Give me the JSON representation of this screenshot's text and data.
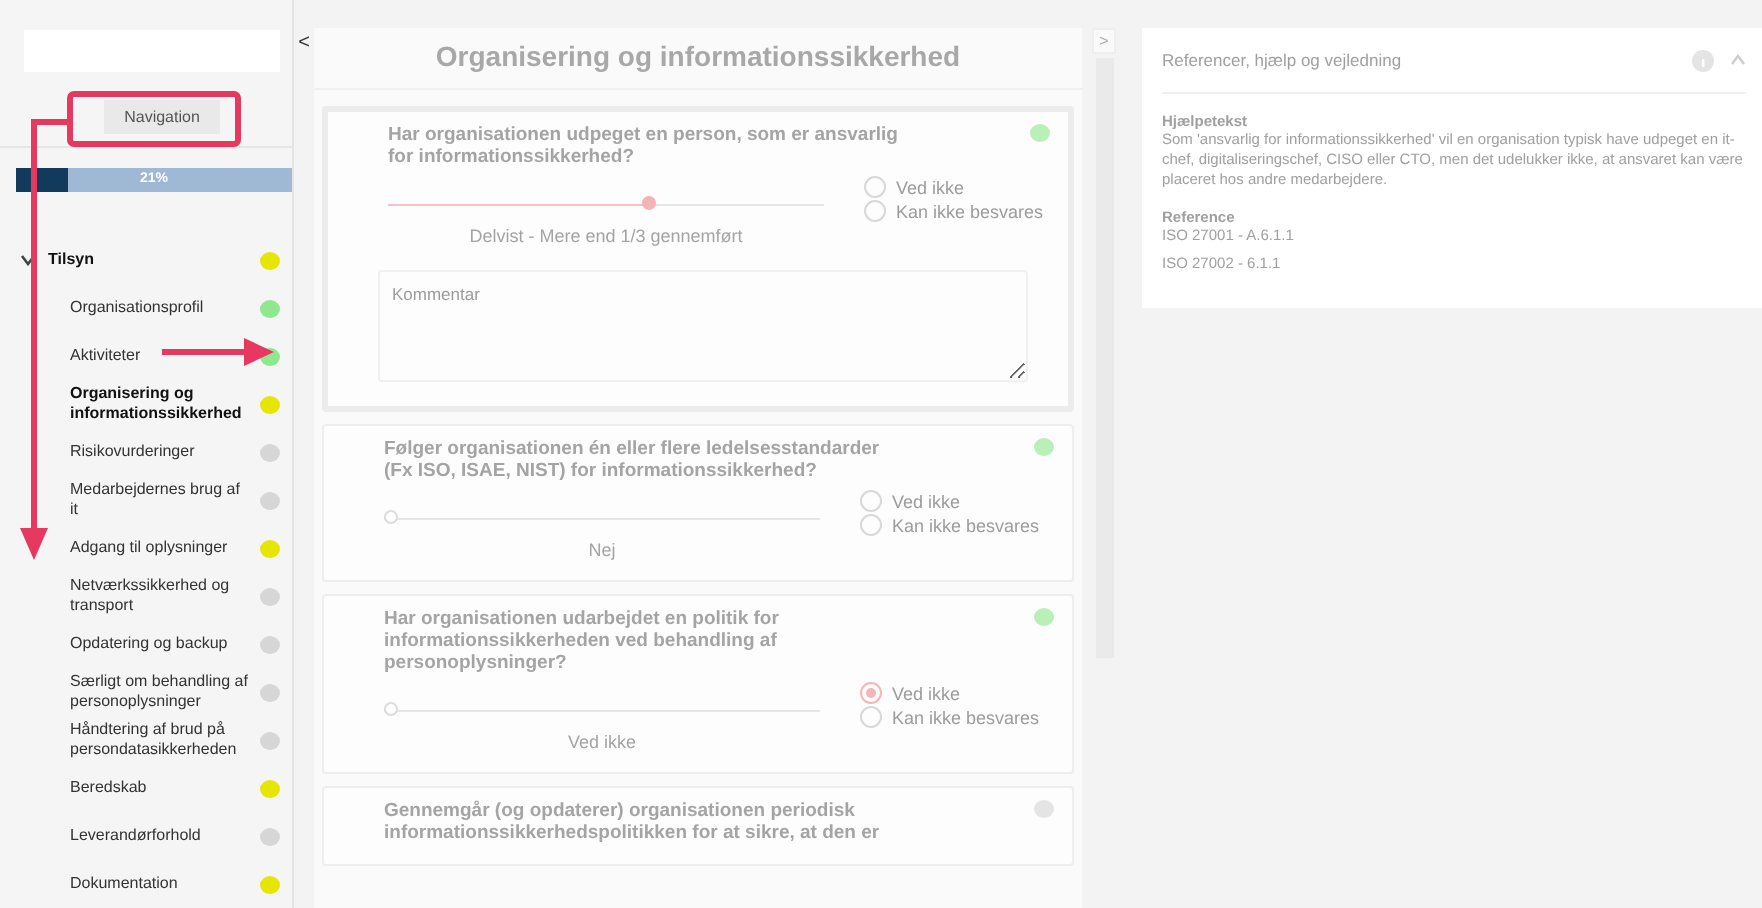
{
  "sidebar": {
    "tab": "Navigation",
    "progress": {
      "level": 0.19,
      "label": "21%"
    },
    "tree": {
      "label": "Tilsyn",
      "expanded": true,
      "color": "#e6e600",
      "children": [
        {
          "label": "Organisationsprofil",
          "color": "#8ee88e",
          "selected": false
        },
        {
          "label": "Aktiviteter",
          "color": "#8ee88e",
          "selected": false
        },
        {
          "label": "Organisering og informationssikkerhed",
          "color": "#e6e600",
          "selected": true
        },
        {
          "label": "Risikovurderinger",
          "color": "#d6d6d6",
          "selected": false
        },
        {
          "label": "Medarbejdernes brug af it",
          "color": "#d6d6d6",
          "selected": false
        },
        {
          "label": "Adgang til oplysninger",
          "color": "#e6e600",
          "selected": false
        },
        {
          "label": "Netværkssikkerhed og transport",
          "color": "#d6d6d6",
          "selected": false
        },
        {
          "label": "Opdatering og backup",
          "color": "#d6d6d6",
          "selected": false
        },
        {
          "label": "Særligt om behandling af personoplysninger",
          "color": "#d6d6d6",
          "selected": false
        },
        {
          "label": "Håndtering af brud på persondatasikkerheden",
          "color": "#d6d6d6",
          "selected": false
        },
        {
          "label": "Beredskab",
          "color": "#e6e600",
          "selected": false
        },
        {
          "label": "Leverandørforhold",
          "color": "#d6d6d6",
          "selected": false
        },
        {
          "label": "Dokumentation",
          "color": "#e6e600",
          "selected": false
        }
      ]
    }
  },
  "main": {
    "collapse_left": "<",
    "collapse_right": ">",
    "title": "Organisering og informationssikkerhed",
    "questions": [
      {
        "text": "Har organisationen udpeget en person, som er ansvarlig for informationssikkerhed?",
        "color": "#b8f0b8",
        "level": 0.6,
        "value_label": "Delvist - Mere end 1/3 gennemført",
        "options": [
          {
            "label": "Ved ikke",
            "selected": false
          },
          {
            "label": "Kan ikke besvares",
            "selected": false
          }
        ],
        "comment": {
          "placeholder": "Kommentar"
        }
      },
      {
        "text": "Følger organisationen én eller flere ledelsesstandarder (Fx ISO, ISAE, NIST) for informationssikkerhed?",
        "color": "#b8f0b8",
        "level": 0,
        "value_label": "Nej",
        "options": [
          {
            "label": "Ved ikke",
            "selected": false
          },
          {
            "label": "Kan ikke besvares",
            "selected": false
          }
        ]
      },
      {
        "text": "Har organisationen udarbejdet en politik for informationssikkerheden ved behandling af personoplysninger?",
        "color": "#b8f0b8",
        "level": 0,
        "value_label": "Ved ikke",
        "options": [
          {
            "label": "Ved ikke",
            "selected": true
          },
          {
            "label": "Kan ikke besvares",
            "selected": false
          }
        ]
      },
      {
        "text": "Gennemgår (og opdaterer) organisationen periodisk informationssikkerhedspolitikken for at sikre, at den er",
        "color": "#e4e4e4"
      }
    ]
  },
  "help": {
    "title": "Referencer, hjælp og vejledning",
    "sections": [
      {
        "heading": "Hjælpetekst",
        "lines": [
          "Som 'ansvarlig for informationssikkerhed' vil en organisation typisk have udpeget en it-chef, digitaliseringschef, CISO eller CTO, men det udelukker ikke, at ansvaret kan være placeret hos andre medarbejdere."
        ]
      },
      {
        "heading": "Reference",
        "lines": [
          "ISO 27001 - A.6.1.1",
          "ISO 27002 - 6.1.1"
        ]
      }
    ]
  }
}
